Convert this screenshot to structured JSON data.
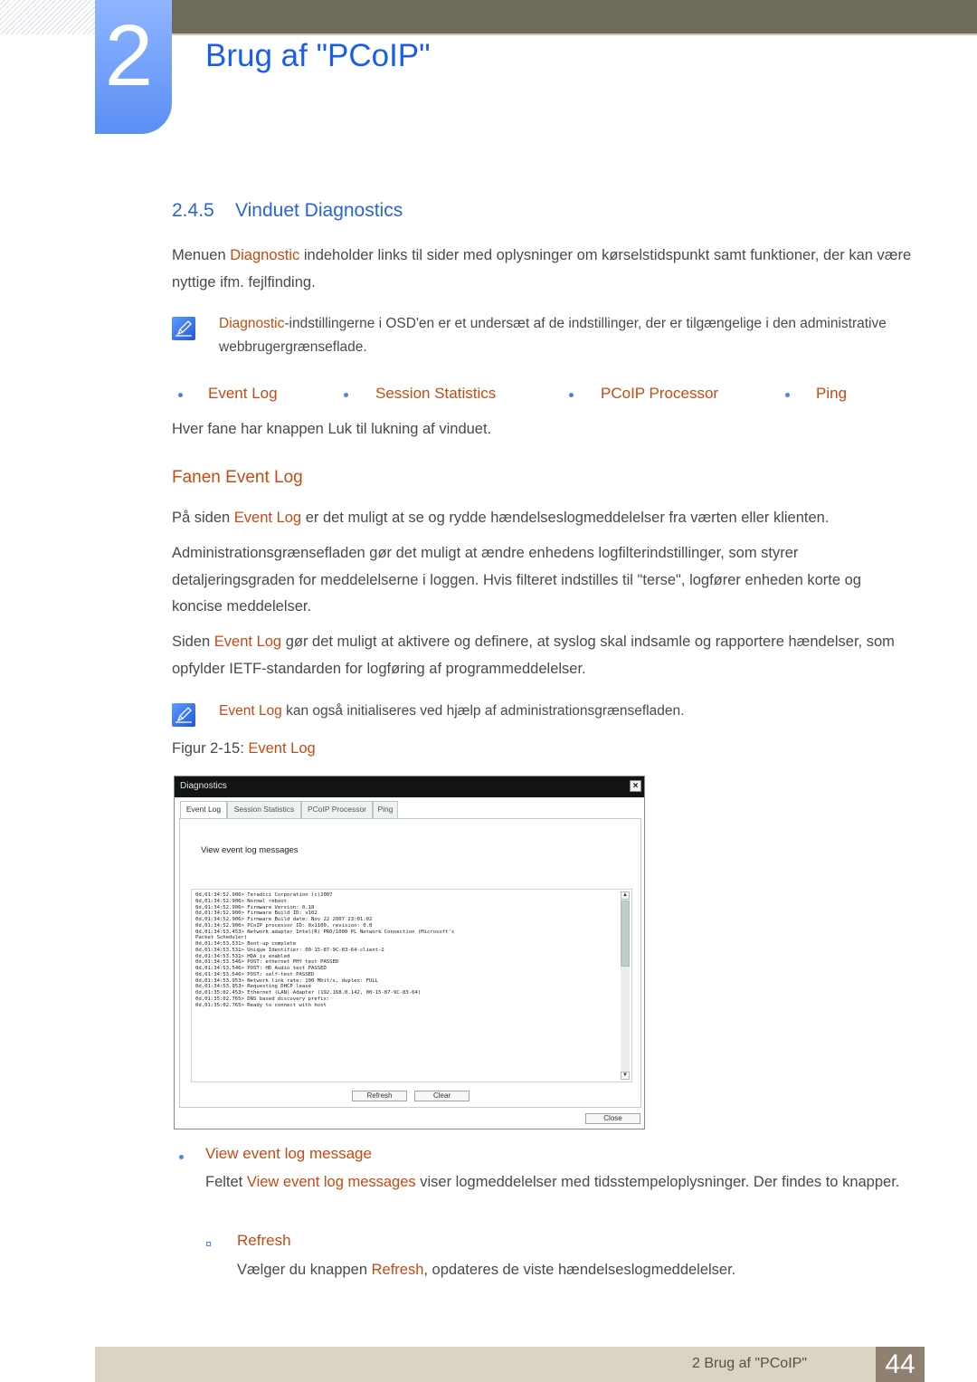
{
  "header": {
    "chapter_number": "2",
    "chapter_title": "Brug af \"PCoIP\""
  },
  "section": {
    "number": "2.4.5",
    "title": "Vinduet Diagnostics"
  },
  "intro": {
    "before": "Menuen ",
    "highlight": "Diagnostic",
    "after": " indeholder links til sider med oplysninger om kørselstidspunkt samt funktioner, der kan være nyttige ifm. fejlfinding."
  },
  "note1": {
    "highlight": "Diagnostic",
    "after": "-indstillingerne i OSD'en er et undersæt af de indstillinger, der er tilgængelige i den administrative webbrugergrænseflade."
  },
  "links": [
    {
      "label": "Event Log"
    },
    {
      "label": "Session Statistics"
    },
    {
      "label": "PCoIP Processor"
    },
    {
      "label": "Ping"
    }
  ],
  "close_note": "Hver fane har knappen Luk til lukning af vinduet.",
  "subsection": {
    "title": "Fanen Event Log"
  },
  "para1": {
    "before": "På siden ",
    "highlight": "Event Log",
    "after": " er det muligt at se og rydde hændelseslogmeddelelser fra værten eller klienten."
  },
  "para2": "Administrationsgrænsefladen gør det muligt at ændre enhedens logfilterindstillinger, som styrer detaljeringsgraden for meddelelserne i loggen. Hvis filteret indstilles til \"terse\", logfører enheden korte og koncise meddelelser.",
  "para3": {
    "before": "Siden ",
    "highlight": "Event Log",
    "after": " gør det muligt at aktivere og definere, at syslog skal indsamle og rapportere hændelser, som opfylder IETF-standarden for logføring af programmeddelelser."
  },
  "note2": {
    "highlight": "Event Log",
    "after": " kan også initialiseres ved hjælp af administrationsgrænsefladen."
  },
  "figure": {
    "caption_prefix": "Figur 2-15: ",
    "caption_highlight": "Event Log"
  },
  "dialog": {
    "title": "Diagnostics",
    "close_glyph": "×",
    "tabs": [
      {
        "label": "Event Log",
        "active": true
      },
      {
        "label": "Session Statistics",
        "active": false
      },
      {
        "label": "PCoIP Processor",
        "active": false
      },
      {
        "label": "Ping",
        "active": false
      }
    ],
    "field_label": "View event log messages",
    "log_lines": [
      "0d,01:34:52.906> Teradici Corporation (c)2007",
      "0d,01:34:52.906> Normal reboot",
      "0d,01:34:52.906> Firmware Version: 0.18",
      "0d,01:34:52.906> Firmware Build ID: v102",
      "0d,01:34:52.906> Firmware Build date: Nov 22 2007 23:01:02",
      "0d,01:34:52.906> PCoIP processor ID: 0x1100, revision: 0.0",
      "0d,01:34:53.453> Network adapter Intel(R) PRO/1000 PL Network Connection (Microsoft's",
      "Packet Scheduler)",
      "0d,01:34:53.531> Boot-up complete",
      "0d,01:34:53.531> Unique Identifier: 00-15-87-9C-83-64-client-2",
      "0d,01:34:53.531> HDA is enabled",
      "0d,01:34:53.546> POST: ethernet PHY test PASSED",
      "0d,01:34:53.546> POST: HD Audio test PASSED",
      "0d,01:34:53.546> POST: self-test PASSED",
      "0d,01:34:53.953> Network link rate: 100 Mbit/s, duplex: FULL",
      "0d,01:34:53.953> Requesting DHCP lease",
      "0d,01:35:02.453> Ethernet (LAN) Adapter (192.168.0.142, 00-15-87-9C-83-64)",
      "0d,01:35:02.765> DNS based discovery prefix:",
      "0d,01:35:02.765> Ready to connect with host"
    ],
    "scroll_up_glyph": "▲",
    "scroll_down_glyph": "▼",
    "refresh_label": "Refresh",
    "clear_label": "Clear",
    "close_label": "Close"
  },
  "item_view": {
    "title": "View event log message",
    "desc_before": "Feltet ",
    "desc_highlight": "View event log messages",
    "desc_after": " viser logmeddelelser med tidsstempeloplysninger. Der findes to knapper."
  },
  "item_refresh": {
    "title": "Refresh",
    "desc_before": "Vælger du knappen ",
    "desc_highlight": "Refresh",
    "desc_after": ", opdateres de viste hændelseslogmeddelelser."
  },
  "footer": {
    "chapter_label": "2 Brug af \"PCoIP\"",
    "page_number": "44"
  },
  "colors": {
    "title_blue": "#1a5cf0",
    "highlight_orange": "#c84a12",
    "footer_bg": "#dad4c2",
    "footer_page_bg": "#8f8070",
    "top_bar": "#6e6b59"
  }
}
